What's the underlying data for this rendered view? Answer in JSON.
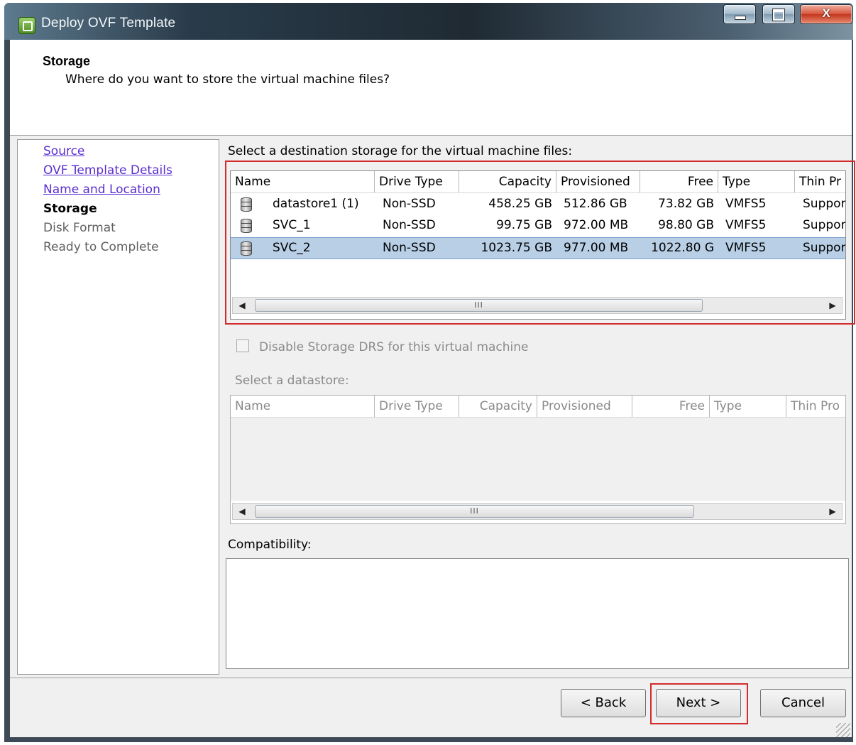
{
  "window": {
    "title": "Deploy OVF Template",
    "close_label": "X"
  },
  "header": {
    "title": "Storage",
    "subtitle": "Where do you want to store the virtual machine files?"
  },
  "nav": {
    "items": [
      {
        "label": "Source",
        "state": "link"
      },
      {
        "label": "OVF Template Details",
        "state": "link"
      },
      {
        "label": "Name and Location",
        "state": "link"
      },
      {
        "label": "Storage",
        "state": "current"
      },
      {
        "label": "Disk Format",
        "state": "disabled"
      },
      {
        "label": "Ready to Complete",
        "state": "disabled"
      }
    ]
  },
  "storage": {
    "label": "Select a destination storage for the virtual machine files:",
    "columns": [
      "Name",
      "Drive Type",
      "Capacity",
      "Provisioned",
      "Free",
      "Type",
      "Thin Pr"
    ],
    "rows": [
      {
        "name": "datastore1 (1)",
        "drive_type": "Non-SSD",
        "capacity": "458.25 GB",
        "provisioned": "512.86 GB",
        "free": "73.82 GB",
        "type": "VMFS5",
        "thin": "Suppor"
      },
      {
        "name": "SVC_1",
        "drive_type": "Non-SSD",
        "capacity": "99.75 GB",
        "provisioned": "972.00 MB",
        "free": "98.80 GB",
        "type": "VMFS5",
        "thin": "Suppor"
      },
      {
        "name": "SVC_2",
        "drive_type": "Non-SSD",
        "capacity": "1023.75 GB",
        "provisioned": "977.00 MB",
        "free": "1022.80 G",
        "type": "VMFS5",
        "thin": "Suppor",
        "selected": true
      }
    ],
    "scroll_grip": "III"
  },
  "drs": {
    "checkbox_label": "Disable Storage DRS for this virtual machine",
    "checked": false
  },
  "datastore": {
    "label": "Select a datastore:",
    "columns": [
      "Name",
      "Drive Type",
      "Capacity",
      "Provisioned",
      "Free",
      "Type",
      "Thin Pro"
    ],
    "scroll_grip": "III"
  },
  "compatibility": {
    "label": "Compatibility:"
  },
  "buttons": {
    "back": "< Back",
    "next": "Next >",
    "cancel": "Cancel"
  },
  "colors": {
    "highlight_border": "#d32c2c",
    "selected_row": "#b8cfe6",
    "link": "#5a2ecf"
  }
}
